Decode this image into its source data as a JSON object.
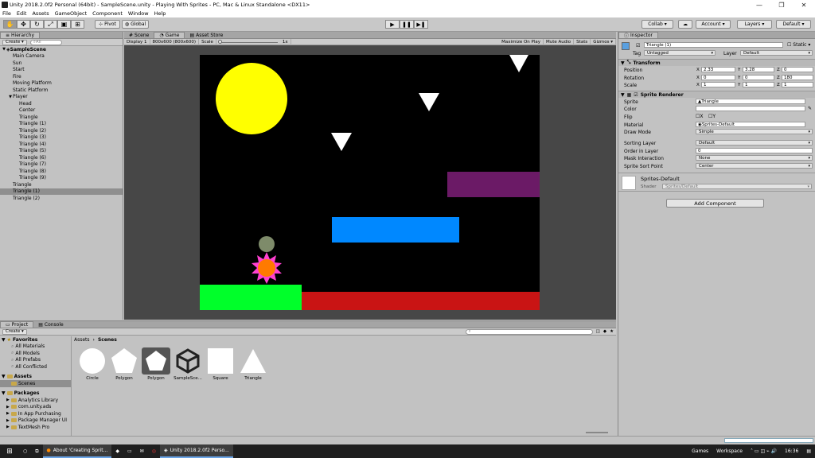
{
  "window": {
    "title": "Unity 2018.2.0f2 Personal (64bit) - SampleScene.unity - Playing With Sprites - PC, Mac & Linux Standalone <DX11>"
  },
  "menu": [
    "File",
    "Edit",
    "Assets",
    "GameObject",
    "Component",
    "Window",
    "Help"
  ],
  "toolbar": {
    "pivot": "Pivot",
    "global": "Global",
    "collab": "Collab ▾",
    "account": "Account",
    "layers": "Layers",
    "layout": "Default"
  },
  "hierarchy": {
    "tab": "Hierarchy",
    "create": "Create ▾",
    "search_placeholder": "All",
    "scene": "SampleScene",
    "items": [
      {
        "label": "Main Camera",
        "indent": 1
      },
      {
        "label": "Sun",
        "indent": 1
      },
      {
        "label": "Start",
        "indent": 1
      },
      {
        "label": "Fire",
        "indent": 1
      },
      {
        "label": "Moving Platform",
        "indent": 1
      },
      {
        "label": "Static Platform",
        "indent": 1
      },
      {
        "label": "Player",
        "indent": 1,
        "expanded": true
      },
      {
        "label": "Head",
        "indent": 2
      },
      {
        "label": "Center",
        "indent": 2
      },
      {
        "label": "Triangle",
        "indent": 2
      },
      {
        "label": "Triangle (1)",
        "indent": 2
      },
      {
        "label": "Triangle (2)",
        "indent": 2
      },
      {
        "label": "Triangle (3)",
        "indent": 2
      },
      {
        "label": "Triangle (4)",
        "indent": 2
      },
      {
        "label": "Triangle (5)",
        "indent": 2
      },
      {
        "label": "Triangle (6)",
        "indent": 2
      },
      {
        "label": "Triangle (7)",
        "indent": 2
      },
      {
        "label": "Triangle (8)",
        "indent": 2
      },
      {
        "label": "Triangle (9)",
        "indent": 2
      },
      {
        "label": "Triangle",
        "indent": 1
      },
      {
        "label": "Triangle (1)",
        "indent": 1,
        "selected": true
      },
      {
        "label": "Triangle (2)",
        "indent": 1
      }
    ]
  },
  "game": {
    "tabs": [
      "Scene",
      "Game",
      "Asset Store"
    ],
    "display": "Display 1",
    "resolution": "800x600 (800x600)",
    "scale_label": "Scale",
    "scale_value": "1x",
    "options": [
      "Maximize On Play",
      "Mute Audio",
      "Stats",
      "Gizmos ▾"
    ]
  },
  "inspector": {
    "tab": "Inspector",
    "object_name": "Triangle (1)",
    "static_label": "Static ▾",
    "tag_label": "Tag",
    "tag": "Untagged",
    "layer_label": "Layer",
    "layer": "Default",
    "transform": {
      "title": "Transform",
      "position_label": "Position",
      "position": {
        "x": "2.33",
        "y": "3.28",
        "z": "0"
      },
      "rotation_label": "Rotation",
      "rotation": {
        "x": "0",
        "y": "0",
        "z": "180"
      },
      "scale_label": "Scale",
      "scale": {
        "x": "1",
        "y": "1",
        "z": "1"
      }
    },
    "sprite_renderer": {
      "title": "Sprite Renderer",
      "sprite_label": "Sprite",
      "sprite": "Triangle",
      "color_label": "Color",
      "flip_label": "Flip",
      "flip_x": "X",
      "flip_y": "Y",
      "material_label": "Material",
      "material": "Sprites-Default",
      "draw_mode_label": "Draw Mode",
      "draw_mode": "Simple",
      "sorting_layer_label": "Sorting Layer",
      "sorting_layer": "Default",
      "order_label": "Order in Layer",
      "order": "0",
      "mask_label": "Mask Interaction",
      "mask": "None",
      "sort_point_label": "Sprite Sort Point",
      "sort_point": "Center"
    },
    "material_block": {
      "name": "Sprites-Default",
      "shader_label": "Shader",
      "shader": "Sprites/Default"
    },
    "add_component": "Add Component"
  },
  "project": {
    "tabs": [
      "Project",
      "Console"
    ],
    "create": "Create ▾",
    "favorites": {
      "title": "Favorites",
      "items": [
        "All Materials",
        "All Models",
        "All Prefabs",
        "All Conflicted"
      ]
    },
    "assets": {
      "title": "Assets",
      "items": [
        "Scenes"
      ]
    },
    "packages": {
      "title": "Packages",
      "items": [
        "Analytics Library",
        "com.unity.ads",
        "In App Purchasing",
        "Package Manager UI",
        "TextMesh Pro"
      ]
    },
    "breadcrumb": [
      "Assets",
      "Scenes"
    ],
    "files": [
      "Circle",
      "Polygon",
      "Polygon",
      "SampleSce...",
      "Square",
      "Triangle"
    ]
  },
  "taskbar": {
    "items": [
      "About 'Creating Sprit...",
      "Unity 2018.2.0f2 Perso..."
    ],
    "tray": [
      "Games",
      "Workspace"
    ],
    "time": "16:36"
  },
  "colors": {
    "sun": "#ffff00",
    "head": "#7e8b6a",
    "body_spikes": "#ff3fd0",
    "body_core": "#ff7a00",
    "start": "#00ff2a",
    "fire": "#c91414",
    "moving": "#0088ff",
    "static": "#6b1a66"
  }
}
